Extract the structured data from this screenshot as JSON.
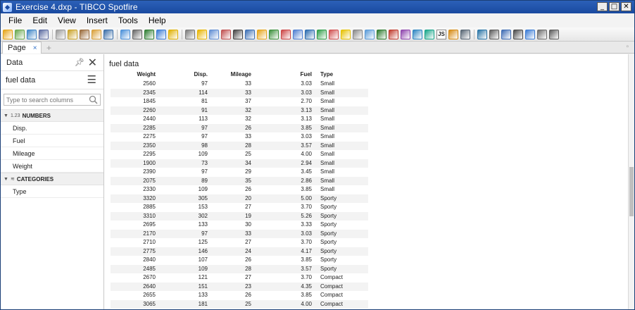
{
  "window": {
    "title": "Exercise 4.dxp - TIBCO Spotfire",
    "controls": [
      "_",
      "□",
      "✕"
    ]
  },
  "menu": [
    "File",
    "Edit",
    "View",
    "Insert",
    "Tools",
    "Help"
  ],
  "toolbar": {
    "js_label": "JS",
    "icon_colors": [
      "#e6a417",
      "#6aa84f",
      "#3d85c6",
      "#5a6aa0",
      "#999999",
      "#c9a227",
      "#9a6a3a",
      "#d9a03a",
      "#3a6ea8",
      "#4a90d9",
      "#666666",
      "#2e7d32",
      "#3a7bd5",
      "#e0b000",
      "#7a7a7a",
      "#e8b400",
      "#5f8dd3",
      "#c05050",
      "#444444",
      "#3c6fb4",
      "#e6a417",
      "#3a8f3a",
      "#cc4444",
      "#4f7fd1",
      "#2b6cb0",
      "#2e9e47",
      "#d14f4f",
      "#e6c100",
      "#888888",
      "#5a9bd8",
      "#2c7a2c",
      "#c0392b",
      "#8e44ad",
      "#2e86c1",
      "#17a589",
      "#d68910",
      "#566573",
      "#2874a6",
      "#5b5b5b",
      "#3d6bb3",
      "#4a4a4a",
      "#3a7bd5",
      "#6c6c6c",
      "#5a5a5a"
    ]
  },
  "tabs": {
    "page_tab": "Page",
    "close": "×",
    "add": "+",
    "right_marker": "▫"
  },
  "data_panel": {
    "title": "Data",
    "source": "fuel data",
    "search_placeholder": "Type to search columns",
    "numbers_group": "NUMBERS",
    "numbers_icon": "1.23",
    "number_columns": [
      "Disp.",
      "Fuel",
      "Mileage",
      "Weight"
    ],
    "categories_group": "CATEGORIES",
    "category_columns": [
      "Type"
    ]
  },
  "visualization": {
    "title": "fuel data",
    "columns": [
      "Weight",
      "Disp.",
      "Mileage",
      "Fuel",
      "Type"
    ],
    "rows": [
      [
        "2560",
        "97",
        "33",
        "3.03",
        "Small"
      ],
      [
        "2345",
        "114",
        "33",
        "3.03",
        "Small"
      ],
      [
        "1845",
        "81",
        "37",
        "2.70",
        "Small"
      ],
      [
        "2260",
        "91",
        "32",
        "3.13",
        "Small"
      ],
      [
        "2440",
        "113",
        "32",
        "3.13",
        "Small"
      ],
      [
        "2285",
        "97",
        "26",
        "3.85",
        "Small"
      ],
      [
        "2275",
        "97",
        "33",
        "3.03",
        "Small"
      ],
      [
        "2350",
        "98",
        "28",
        "3.57",
        "Small"
      ],
      [
        "2295",
        "109",
        "25",
        "4.00",
        "Small"
      ],
      [
        "1900",
        "73",
        "34",
        "2.94",
        "Small"
      ],
      [
        "2390",
        "97",
        "29",
        "3.45",
        "Small"
      ],
      [
        "2075",
        "89",
        "35",
        "2.86",
        "Small"
      ],
      [
        "2330",
        "109",
        "26",
        "3.85",
        "Small"
      ],
      [
        "3320",
        "305",
        "20",
        "5.00",
        "Sporty"
      ],
      [
        "2885",
        "153",
        "27",
        "3.70",
        "Sporty"
      ],
      [
        "3310",
        "302",
        "19",
        "5.26",
        "Sporty"
      ],
      [
        "2695",
        "133",
        "30",
        "3.33",
        "Sporty"
      ],
      [
        "2170",
        "97",
        "33",
        "3.03",
        "Sporty"
      ],
      [
        "2710",
        "125",
        "27",
        "3.70",
        "Sporty"
      ],
      [
        "2775",
        "146",
        "24",
        "4.17",
        "Sporty"
      ],
      [
        "2840",
        "107",
        "26",
        "3.85",
        "Sporty"
      ],
      [
        "2485",
        "109",
        "28",
        "3.57",
        "Sporty"
      ],
      [
        "2670",
        "121",
        "27",
        "3.70",
        "Compact"
      ],
      [
        "2640",
        "151",
        "23",
        "4.35",
        "Compact"
      ],
      [
        "2655",
        "133",
        "26",
        "3.85",
        "Compact"
      ],
      [
        "3065",
        "181",
        "25",
        "4.00",
        "Compact"
      ]
    ]
  }
}
